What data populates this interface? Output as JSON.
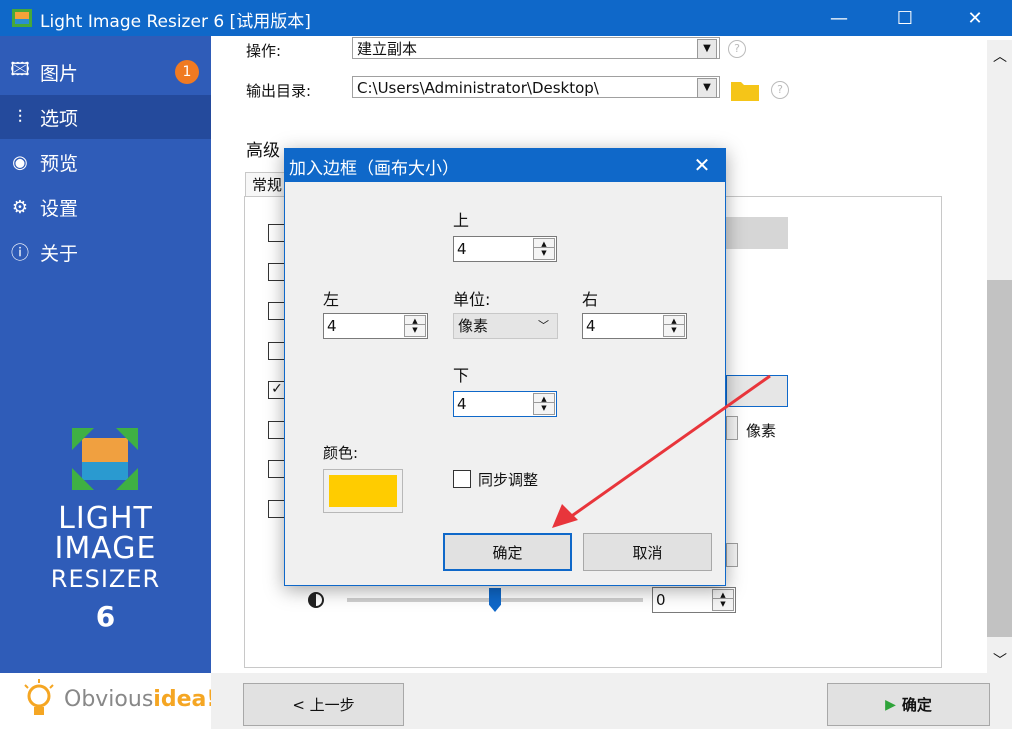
{
  "window": {
    "title": "Light Image Resizer 6  [试用版本]",
    "colors": {
      "titlebar": "#0f68c9",
      "sidebar": "#2f5cb8",
      "accent_badge": "#f07a22"
    }
  },
  "sidebar": {
    "items": [
      {
        "label": "图片",
        "icon": "image-icon",
        "badge": "1"
      },
      {
        "label": "选项",
        "icon": "sliders-icon"
      },
      {
        "label": "预览",
        "icon": "eye-icon"
      },
      {
        "label": "设置",
        "icon": "gear-icon"
      },
      {
        "label": "关于",
        "icon": "info-icon"
      }
    ],
    "brand": {
      "line1": "LIGHT",
      "line2": "IMAGE",
      "line3": "RESIZER",
      "line4": "6"
    },
    "footer": {
      "logo_obvious": "Obvious",
      "logo_idea": "idea!"
    }
  },
  "main": {
    "operation_label": "操作:",
    "operation_value": "建立副本",
    "output_dir_label": "输出目录:",
    "output_dir_value": "C:\\Users\\Administrator\\Desktop\\",
    "help_glyph": "?",
    "advanced_label": "高级",
    "tab_general": "常规",
    "pixels_label": "像素",
    "brightness_value": "0"
  },
  "bottom": {
    "back_label": "< 上一步",
    "ok_label": "确定"
  },
  "dialog": {
    "title": "加入边框（画布大小）",
    "top_label": "上",
    "top_value": "4",
    "left_label": "左",
    "left_value": "4",
    "unit_label": "单位:",
    "unit_value": "像素",
    "right_label": "右",
    "right_value": "4",
    "bottom_label": "下",
    "bottom_value": "4",
    "color_label": "颜色:",
    "color_value": "#ffcc00",
    "sync_label": "同步调整",
    "ok_label": "确定",
    "cancel_label": "取消"
  }
}
